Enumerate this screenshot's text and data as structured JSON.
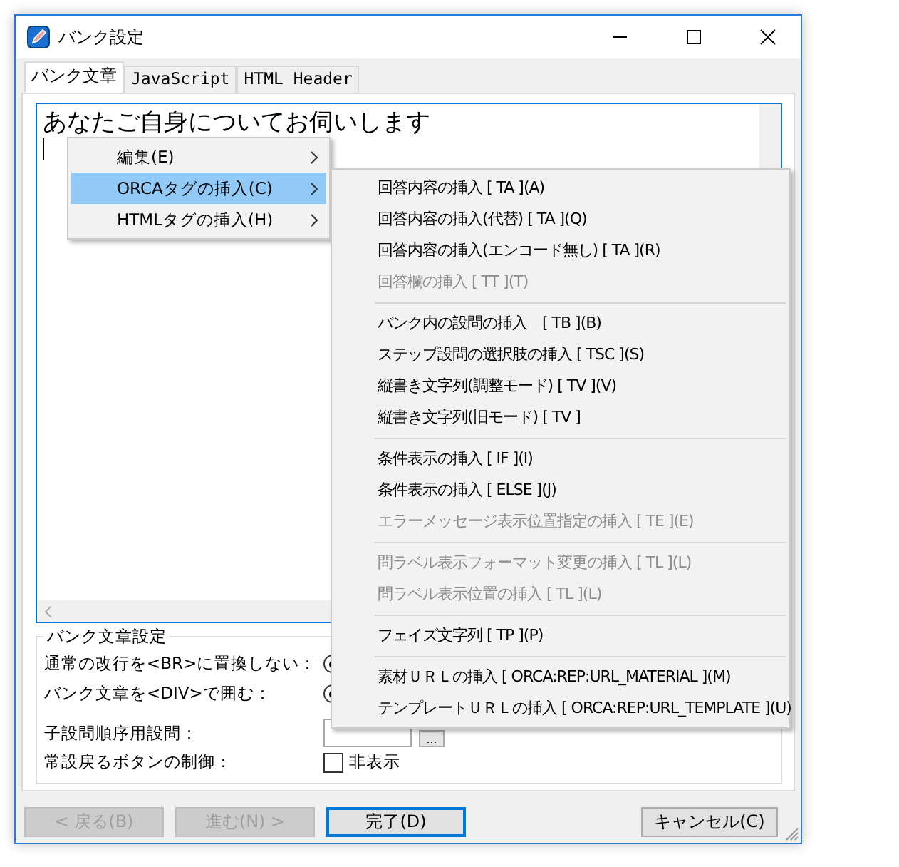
{
  "window": {
    "title": "バンク設定"
  },
  "tabs": [
    {
      "label": "バンク文章",
      "selected": true
    },
    {
      "label": "JavaScript",
      "selected": false
    },
    {
      "label": "HTML Header",
      "selected": false
    }
  ],
  "editor": {
    "text": "あなたご自身についてお伺いします"
  },
  "context_menu": {
    "items": [
      {
        "label": "編集(E)",
        "selected": false,
        "submenu": true
      },
      {
        "label": "ORCAタグの挿入(C)",
        "selected": true,
        "submenu": true
      },
      {
        "label": "HTMLタグの挿入(H)",
        "selected": false,
        "submenu": true
      }
    ]
  },
  "submenu": {
    "groups": [
      [
        {
          "label": "回答内容の挿入 [ TA ](A)",
          "disabled": false
        },
        {
          "label": "回答内容の挿入(代替) [ TA ](Q)",
          "disabled": false
        },
        {
          "label": "回答内容の挿入(エンコード無し) [ TA ](R)",
          "disabled": false
        },
        {
          "label": "回答欄の挿入 [ TT ](T)",
          "disabled": true
        }
      ],
      [
        {
          "label": "バンク内の設問の挿入　[ TB ](B)",
          "disabled": false
        },
        {
          "label": "ステップ設問の選択肢の挿入 [ TSC ](S)",
          "disabled": false
        },
        {
          "label": "縦書き文字列(調整モード) [ TV ](V)",
          "disabled": false
        },
        {
          "label": "縦書き文字列(旧モード) [ TV ]",
          "disabled": false
        }
      ],
      [
        {
          "label": "条件表示の挿入 [ IF ](I)",
          "disabled": false
        },
        {
          "label": "条件表示の挿入 [ ELSE ](J)",
          "disabled": false
        },
        {
          "label": "エラーメッセージ表示位置指定の挿入 [ TE ](E)",
          "disabled": true
        }
      ],
      [
        {
          "label": "問ラベル表示フォーマット変更の挿入 [ TL ](L)",
          "disabled": true
        },
        {
          "label": "問ラベル表示位置の挿入 [ TL ](L)",
          "disabled": true
        }
      ],
      [
        {
          "label": "フェイズ文字列 [ TP ](P)",
          "disabled": false
        }
      ],
      [
        {
          "label": "素材ＵＲＬの挿入 [ ORCA:REP:URL_MATERIAL ](M)",
          "disabled": false
        },
        {
          "label": "テンプレートＵＲＬの挿入 [ ORCA:REP:URL_TEMPLATE ](U)",
          "disabled": false
        }
      ]
    ]
  },
  "settings": {
    "title": "バンク文章設定",
    "rows": [
      {
        "kind": "radio",
        "label": "通常の改行を<BR>に置換しない：",
        "checked": true
      },
      {
        "kind": "radio",
        "label": "バンク文章を<DIV>で囲む：",
        "checked": true
      },
      {
        "kind": "field",
        "label": "子設問順序用設問：",
        "button": "..."
      },
      {
        "kind": "checkbox",
        "label": "常設戻るボタンの制御：",
        "option": "非表示",
        "checked": false
      }
    ]
  },
  "buttons": [
    {
      "label": "< 戻る(B)",
      "disabled": true,
      "default": false
    },
    {
      "label": "進む(N) >",
      "disabled": true,
      "default": false
    },
    {
      "label": "完了(D)",
      "disabled": false,
      "default": true
    },
    {
      "label": "キャンセル(C)",
      "disabled": false,
      "default": false
    }
  ]
}
